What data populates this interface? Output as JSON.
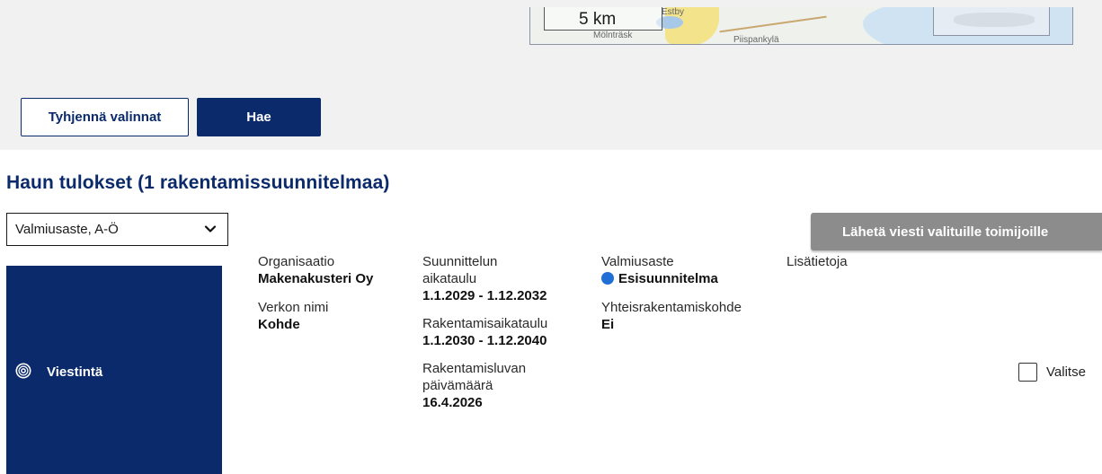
{
  "map": {
    "scale_label": "5 km",
    "place_labels": [
      "Estby",
      "Mölnträsk",
      "Piispankylä"
    ]
  },
  "search": {
    "clear_label": "Tyhjennä valinnat",
    "search_label": "Hae"
  },
  "results": {
    "title": "Haun tulokset (1 rakentamissuunnitelmaa)",
    "sort_value": "Valmiusaste, A-Ö",
    "send_label": "Lähetä viesti valituille toimijoille"
  },
  "card": {
    "category": "Viestintä",
    "organisation_label": "Organisaatio",
    "organisation": "Makenakusteri Oy",
    "network_label": "Verkon nimi",
    "network": "Kohde",
    "planning_label_1": "Suunnittelun",
    "planning_label_2": "aikataulu",
    "planning_value": "1.1.2029 - 1.12.2032",
    "construction_label": "Rakentamisaikataulu",
    "construction_value": "1.1.2030 - 1.12.2040",
    "permit_label_1": "Rakentamisluvan",
    "permit_label_2": "päivämäärä",
    "permit_value": "16.4.2026",
    "status_label": "Valmiusaste",
    "status_value": "Esisuunnitelma",
    "status_color": "#1f6fd6",
    "joint_label": "Yhteisrakentamiskohde",
    "joint_value": "Ei",
    "extra_label": "Lisätietoja",
    "select_label": "Valitse"
  },
  "colors": {
    "brand": "#0b2a6b",
    "disabled_button": "#8c8c8c"
  }
}
